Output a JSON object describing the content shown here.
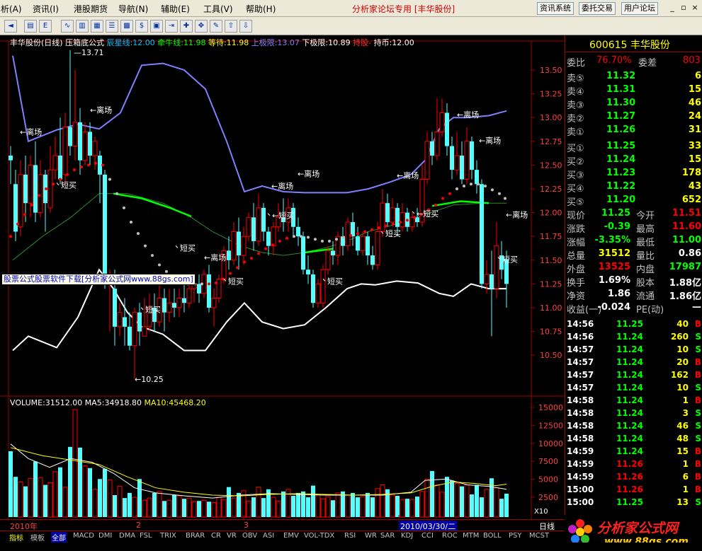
{
  "menubar": {
    "items": [
      "析(A)",
      "资讯(I)",
      "港股期货",
      "导航(N)",
      "辅助(E)",
      "工具(V)",
      "帮助(H)"
    ],
    "app_title": "分析家论坛专用 [丰华股份]",
    "buttons": [
      "资讯系统",
      "委托交易",
      "用户论坛"
    ]
  },
  "chart": {
    "header": {
      "title": "丰华股份(日线)",
      "formula": "压箱底公式",
      "l1": "辰星线:12.00",
      "l2": "牵牛线:11.98",
      "l3": "等待:11.98",
      "l4": "上极限:13.07",
      "l5": "下极限:10.89",
      "l6": "持股-",
      "l7": "持币:12.00"
    },
    "price_axis": [
      "13.50",
      "13.25",
      "13.00",
      "12.75",
      "12.50",
      "12.25",
      "12.00",
      "11.75",
      "11.50",
      "11.25",
      "11.00",
      "10.75",
      "10.50"
    ],
    "high_label": "13.71",
    "low_label": "←10.25",
    "annotations": [
      {
        "text": "←离场",
        "color": "#ffffff"
      },
      {
        "text": "←离场",
        "color": "#ffffff"
      },
      {
        "text": "短买",
        "color": "#ffffff"
      },
      {
        "text": "←离场",
        "color": "#ffffff"
      },
      {
        "text": "←离场",
        "color": "#ffffff"
      },
      {
        "text": "←离场",
        "color": "#ffffff"
      },
      {
        "text": "←离场",
        "color": "#ffffff"
      },
      {
        "text": "←离场",
        "color": "#ffffff"
      },
      {
        "text": "←离场",
        "color": "#ffffff"
      },
      {
        "text": "←离场",
        "color": "#ffffff"
      },
      {
        "text": "←短买",
        "color": "#ffffff"
      },
      {
        "text": "←短买",
        "color": "#ffffff"
      },
      {
        "text": "短买",
        "color": "#ffffff"
      },
      {
        "text": "短买",
        "color": "#ffffff"
      },
      {
        "text": "短买",
        "color": "#ffffff"
      },
      {
        "text": "短买",
        "color": "#ffffff"
      },
      {
        "text": "短买",
        "color": "#ffffff"
      },
      {
        "text": "短买",
        "color": "#ffffff"
      }
    ],
    "watermark": "股票公式股票软件下载[分析家公式网www.88gs.com]",
    "volume_header": {
      "v": "VOLUME:31512.00",
      "ma5": "MA5:34918.80",
      "ma10": "MA10:45468.20"
    },
    "volume_axis": [
      "15000",
      "12500",
      "10000",
      "7500",
      "5000",
      "2500"
    ],
    "volume_unit": "X10",
    "date_labels": [
      "2010年",
      "2",
      "3",
      "2010/03/30/二"
    ],
    "period": "日线"
  },
  "tabs": [
    "指标",
    "模板",
    "全部",
    "MACD",
    "DMI",
    "DMA",
    "FSL",
    "TRIX",
    "BRAR",
    "CR",
    "VR",
    "OBV",
    "ASI",
    "EMV",
    "VOL-TDX",
    "RSI",
    "WR",
    "SAR",
    "KDJ",
    "CCI",
    "ROC",
    "MTM",
    "BOLL",
    "PSY",
    "MCST"
  ],
  "quote": {
    "code_name": "600615 丰华股份",
    "weibi_label": "委比",
    "weibi_value": "76.70%",
    "weicha_label": "委差",
    "weicha_value": "803",
    "asks": [
      {
        "label": "卖⑤",
        "price": "11.32",
        "vol": "6"
      },
      {
        "label": "卖④",
        "price": "11.31",
        "vol": "15"
      },
      {
        "label": "卖③",
        "price": "11.30",
        "vol": "46"
      },
      {
        "label": "卖②",
        "price": "11.27",
        "vol": "24"
      },
      {
        "label": "卖①",
        "price": "11.26",
        "vol": "31"
      }
    ],
    "bids": [
      {
        "label": "买①",
        "price": "11.25",
        "vol": "33"
      },
      {
        "label": "买②",
        "price": "11.24",
        "vol": "15"
      },
      {
        "label": "买③",
        "price": "11.23",
        "vol": "178"
      },
      {
        "label": "买④",
        "price": "11.22",
        "vol": "43"
      },
      {
        "label": "买⑤",
        "price": "11.20",
        "vol": "652"
      }
    ],
    "stats": [
      {
        "l1": "现价",
        "v1": "11.25",
        "c1": "#00ff00",
        "l2": "今开",
        "v2": "11.51",
        "c2": "#ff0000"
      },
      {
        "l1": "涨跌",
        "v1": "-0.39",
        "c1": "#00ff00",
        "l2": "最高",
        "v2": "11.60",
        "c2": "#ff0000"
      },
      {
        "l1": "涨幅",
        "v1": "-3.35%",
        "c1": "#00ff00",
        "l2": "最低",
        "v2": "11.00",
        "c2": "#00ff00"
      },
      {
        "l1": "总量",
        "v1": "31512",
        "c1": "#ffff00",
        "l2": "量比",
        "v2": "0.86",
        "c2": "#ffffff"
      },
      {
        "l1": "外盘",
        "v1": "13525",
        "c1": "#ff0000",
        "l2": "内盘",
        "v2": "17987",
        "c2": "#00ff00"
      },
      {
        "l1": "换手",
        "v1": "1.69%",
        "c1": "#ffffff",
        "l2": "股本",
        "v2": "1.88亿",
        "c2": "#ffffff"
      },
      {
        "l1": "净资",
        "v1": "1.86",
        "c1": "#ffffff",
        "l2": "流通",
        "v2": "1.86亿",
        "c2": "#ffffff"
      },
      {
        "l1": "收益(一)",
        "v1": "-0.024",
        "c1": "#ffffff",
        "l2": "PE(动)",
        "v2": "—",
        "c2": "#ffffff"
      }
    ],
    "ticks": [
      {
        "t": "14:56",
        "p": "11.25",
        "v": "40",
        "s": "B"
      },
      {
        "t": "14:56",
        "p": "11.24",
        "v": "260",
        "s": "S"
      },
      {
        "t": "14:57",
        "p": "11.24",
        "v": "10",
        "s": "S"
      },
      {
        "t": "14:57",
        "p": "11.24",
        "v": "20",
        "s": "B"
      },
      {
        "t": "14:57",
        "p": "11.24",
        "v": "162",
        "s": "B"
      },
      {
        "t": "14:57",
        "p": "11.24",
        "v": "10",
        "s": "S"
      },
      {
        "t": "14:58",
        "p": "11.24",
        "v": "1",
        "s": "B"
      },
      {
        "t": "14:58",
        "p": "11.24",
        "v": "3",
        "s": "S"
      },
      {
        "t": "14:58",
        "p": "11.24",
        "v": "46",
        "s": "S"
      },
      {
        "t": "14:58",
        "p": "11.24",
        "v": "48",
        "s": "S"
      },
      {
        "t": "14:59",
        "p": "11.24",
        "v": "15",
        "s": "B"
      },
      {
        "t": "14:59",
        "p": "11.26",
        "v": "1",
        "s": "B"
      },
      {
        "t": "14:59",
        "p": "11.26",
        "v": "6",
        "s": "B"
      },
      {
        "t": "15:00",
        "p": "11.26",
        "v": "1",
        "s": "B"
      },
      {
        "t": "15:00",
        "p": "11.25",
        "v": "13",
        "s": "S"
      }
    ]
  },
  "logo": {
    "text": "分析家公式网",
    "url": "www.88gs.com"
  },
  "colors": {
    "up": "#ff0000",
    "down": "#54ffff",
    "upper_band": "#8080ff",
    "lower_band": "#ffffff",
    "midline": "#00ff00"
  }
}
